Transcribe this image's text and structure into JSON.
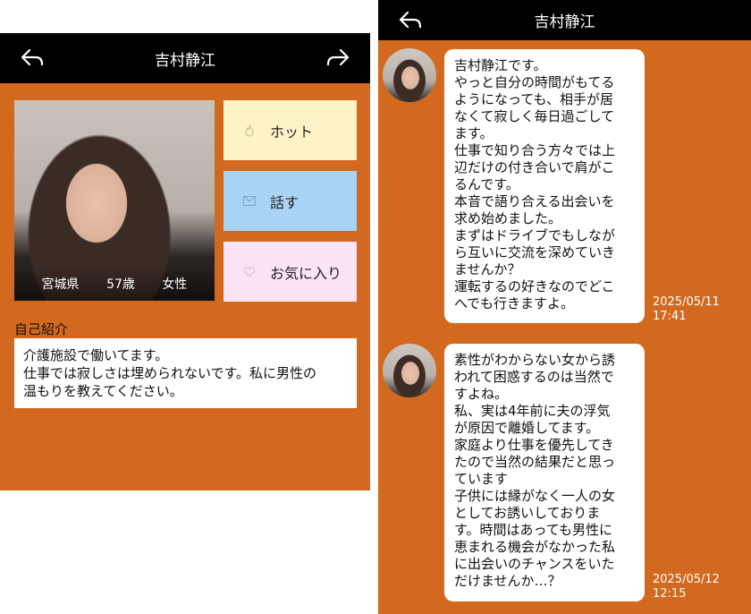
{
  "profile": {
    "header": {
      "title": "吉村静江"
    },
    "tags": {
      "region": "宮城県",
      "age": "57歳",
      "gender": "女性"
    },
    "actions": {
      "hot": "ホット",
      "talk": "話す",
      "favorite": "お気に入り"
    },
    "intro_label": "自己紹介",
    "intro_lines": [
      "介護施設で働いてます。",
      "仕事では寂しさは埋められないです。私に男性の",
      "温もりを教えてください。"
    ]
  },
  "chat": {
    "header": {
      "title": "吉村静江"
    },
    "messages": [
      {
        "lines": [
          "吉村静江です。",
          "やっと自分の時間がもてる",
          "ようになっても、相手が居",
          "なくて寂しく毎日過ごして",
          "ます。",
          "仕事で知り合う方々では上",
          "辺だけの付き合いで肩がこ",
          "るんです。",
          "本音で語り合える出会いを",
          "求め始めました。",
          "まずはドライブでもしなが",
          "ら互いに交流を深めていき",
          "ませんか？",
          "運転するの好きなのでどこ",
          "へでも行きますよ。"
        ],
        "date": "2025/05/11",
        "time": "17:41"
      },
      {
        "lines": [
          "素性がわからない女から誘",
          "われて困惑するのは当然で",
          "すよね。",
          "私、実は4年前に夫の浮気",
          "が原因で離婚してます。",
          "家庭より仕事を優先してき",
          "たので当然の結果だと思っ",
          "ています",
          "子供には縁がなく一人の女",
          "としてお誘いしておりま",
          "す。時間はあっても男性に",
          "恵まれる機会がなかった私",
          "に出会いのチャンスをいた",
          "だけませんか…？"
        ],
        "date": "2025/05/12",
        "time": "12:15"
      }
    ]
  },
  "colors": {
    "panel_bg": "#d2691e",
    "header_bg": "#000000",
    "hot": "#fdf3c6",
    "talk": "#a9d4f5",
    "favorite": "#fde3f6"
  }
}
